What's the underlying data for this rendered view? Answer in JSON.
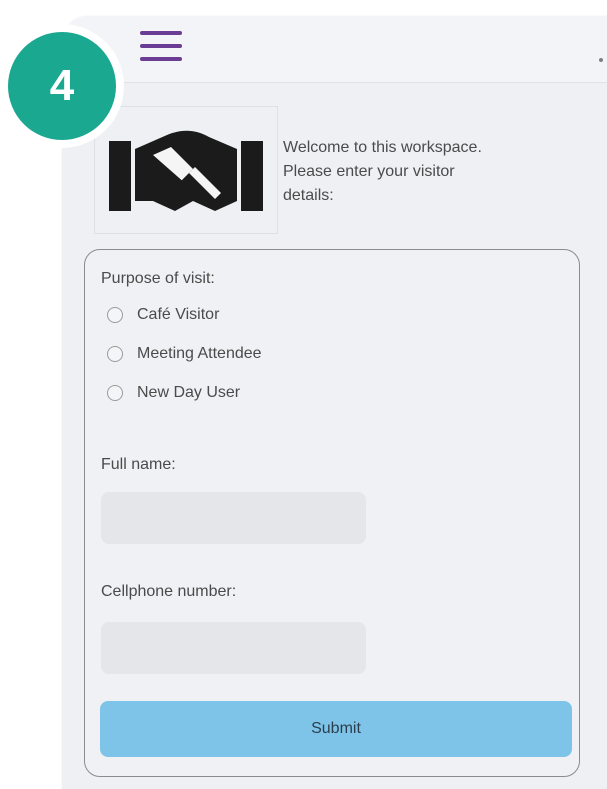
{
  "step": {
    "number": "4"
  },
  "header": {
    "menu_icon": "hamburger-menu-icon"
  },
  "intro": {
    "logo_icon": "handshake-icon",
    "lines": [
      "Welcome to this workspace.",
      "Please enter your visitor",
      "details:"
    ]
  },
  "form": {
    "purpose_label": "Purpose of visit:",
    "purpose_options": [
      "Café Visitor",
      "Meeting Attendee",
      "New Day User"
    ],
    "full_name_label": "Full name:",
    "full_name_value": "",
    "phone_label": "Cellphone number:",
    "phone_value": "",
    "submit_label": "Submit"
  },
  "colors": {
    "accent_teal": "#1aa890",
    "menu_purple": "#6a3c93",
    "submit_blue": "#7ec4e8"
  }
}
